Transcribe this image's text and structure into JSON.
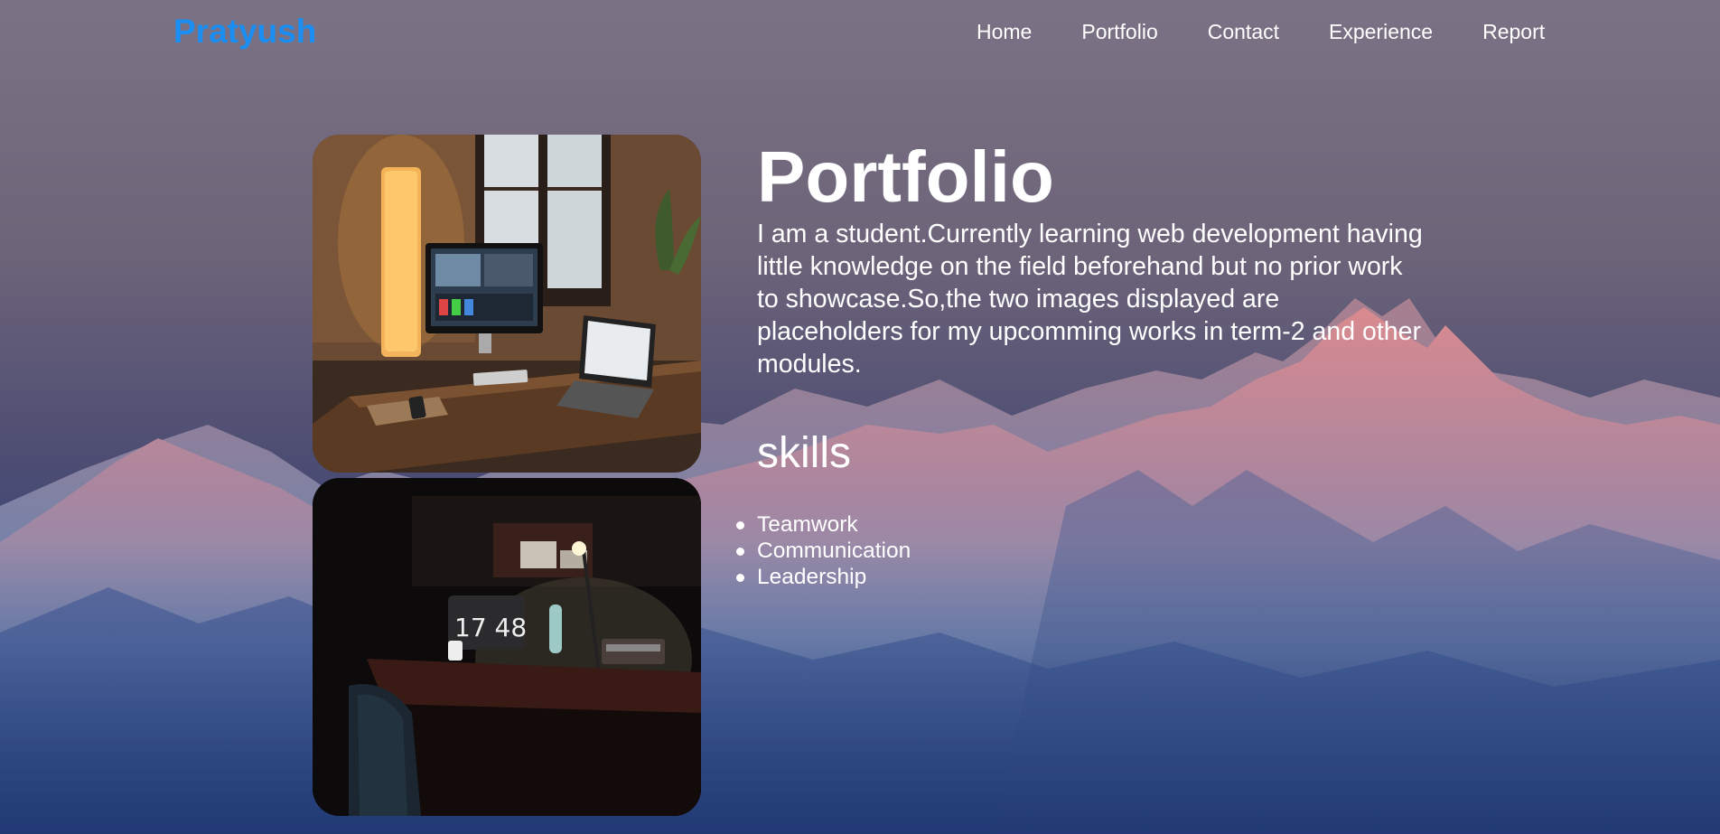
{
  "nav": {
    "logo": "Pratyush",
    "items": [
      {
        "label": "Home"
      },
      {
        "label": "Portfolio"
      },
      {
        "label": "Contact"
      },
      {
        "label": "Experience"
      },
      {
        "label": "Report"
      }
    ]
  },
  "main": {
    "title": "Portfolio",
    "description": "I am a student.Currently learning web development having little knowledge on the field beforehand but no prior work to showcase.So,the two images displayed are placeholders for my upcomming works in term-2 and other modules.",
    "skills_heading": "skills",
    "skills": [
      "Teamwork",
      "Communication",
      "Leadership"
    ]
  },
  "images": {
    "photo1": "desk-setup-photo",
    "photo2": "dark-desk-photo"
  },
  "colors": {
    "logo": "#1a8ef2",
    "text": "#ffffff"
  }
}
